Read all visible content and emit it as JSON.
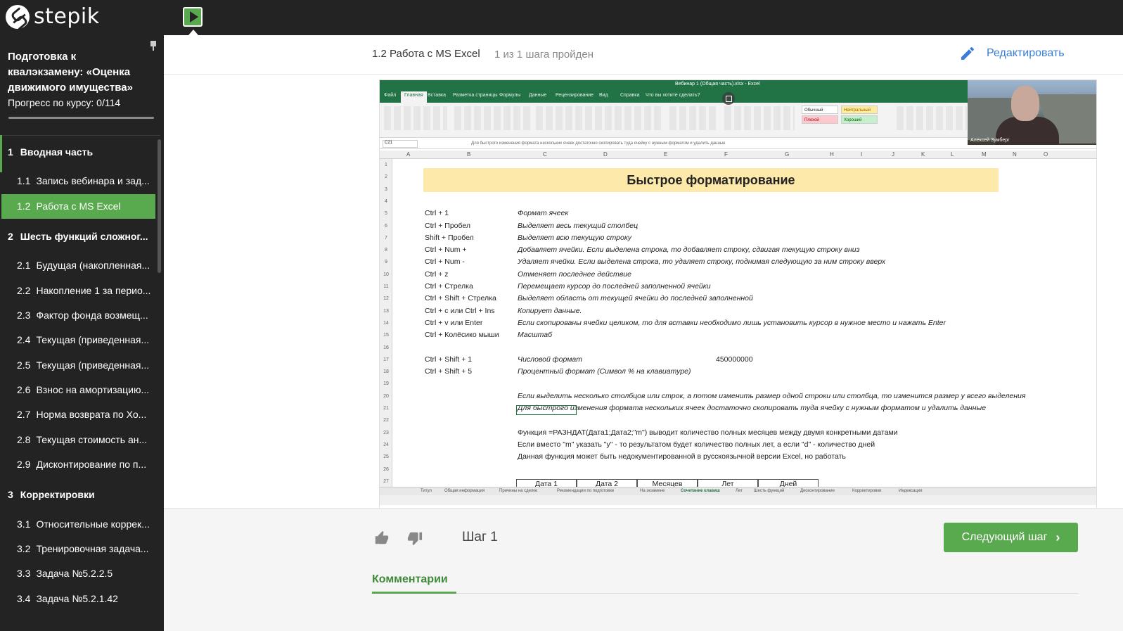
{
  "brand": {
    "name": "stepik"
  },
  "sidebar": {
    "course_title": "Подготовка к квалэкзамену: «Оценка движимого имущества»",
    "progress_label": "Прогресс по курсу:",
    "progress_value": "0/114",
    "progress_fraction": 0.0,
    "modules": [
      {
        "num": "1",
        "title": "Вводная часть",
        "lessons": [
          {
            "num": "1.1",
            "title": "Запись вебинара и зад..."
          },
          {
            "num": "1.2",
            "title": "Работа с MS Excel",
            "active": true
          }
        ]
      },
      {
        "num": "2",
        "title": "Шесть функций сложног...",
        "lessons": [
          {
            "num": "2.1",
            "title": "Будущая (накопленная..."
          },
          {
            "num": "2.2",
            "title": "Накопление 1 за перио..."
          },
          {
            "num": "2.3",
            "title": "Фактор фонда возмещ..."
          },
          {
            "num": "2.4",
            "title": "Текущая (приведенная..."
          },
          {
            "num": "2.5",
            "title": "Текущая (приведенная..."
          },
          {
            "num": "2.6",
            "title": "Взнос на амортизацию..."
          },
          {
            "num": "2.7",
            "title": "Норма возврата по Хо..."
          },
          {
            "num": "2.8",
            "title": "Текущая стоимость ан..."
          },
          {
            "num": "2.9",
            "title": "Дисконтирование по п..."
          }
        ]
      },
      {
        "num": "3",
        "title": "Корректировки",
        "lessons": [
          {
            "num": "3.1",
            "title": "Относительные коррек..."
          },
          {
            "num": "3.2",
            "title": "Тренировочная задача..."
          },
          {
            "num": "3.3",
            "title": "Задача №5.2.2.5"
          },
          {
            "num": "3.4",
            "title": "Задача №5.2.1.42"
          }
        ]
      }
    ]
  },
  "header": {
    "lesson_title": "1.2 Работа с MS Excel",
    "steps_status": "1 из 1 шага пройден",
    "edit_label": "Редактировать"
  },
  "video": {
    "excel_title": "Вебинар 1 (Общая часть).xlsx - Excel",
    "ribbon_tabs": [
      "Файл",
      "Главная",
      "Вставка",
      "Разметка страницы",
      "Формулы",
      "Данные",
      "Рецензирование",
      "Вид",
      "Справка",
      "Что вы хотите сделать?"
    ],
    "style_chips": [
      "Обычный",
      "Нейтральный",
      "Плохой",
      "Хороший"
    ],
    "cell_ref": "C21",
    "formula_text": "Для быстрого изменения формата нескольких ячеек достаточно скопировать туда ячейку с нужным форматом и удалить данные",
    "columns": [
      "A",
      "B",
      "C",
      "D",
      "E",
      "F",
      "G",
      "H",
      "I",
      "J",
      "K",
      "L",
      "M",
      "N",
      "O"
    ],
    "banner": "Быстрое форматирование",
    "shortcuts": [
      {
        "keys": "Ctrl + 1",
        "desc": "Формат ячеек"
      },
      {
        "keys": "Ctrl + Пробел",
        "desc": "Выделяет весь текущий столбец"
      },
      {
        "keys": "Shift + Пробел",
        "desc": "Выделяет всю текущую строку"
      },
      {
        "keys": "Ctrl + Num +",
        "desc": "Добавляет ячейки. Если выделена строка, то добавляет строку, сдвигая текущую строку вниз"
      },
      {
        "keys": "Ctrl + Num -",
        "desc": "Удаляет ячейки. Если выделена строка, то удаляет строку, поднимая следующую за ним строку вверх"
      },
      {
        "keys": "Ctrl + z",
        "desc": "Отменяет последнее действие"
      },
      {
        "keys": "Ctrl + Стрелка",
        "desc": "Перемещает курсор до последней заполненной ячейки"
      },
      {
        "keys": "Ctrl + Shift + Стрелка",
        "desc": "Выделяет область от текущей ячейки до последней заполненной"
      },
      {
        "keys": "Ctrl + c  или Ctrl + Ins",
        "desc": "Копирует данные."
      },
      {
        "keys": "Ctrl + v  или Enter",
        "desc": "Если скопированы ячейки целиком, то для вставки необходимо лишь установить курсор в нужное место и нажать Enter"
      },
      {
        "keys": "Ctrl + Колёсико мыши",
        "desc": "Масштаб"
      }
    ],
    "format_rows": [
      {
        "keys": "Ctrl + Shift + 1",
        "desc": "Числовой формат",
        "value": "450000000"
      },
      {
        "keys": "Ctrl + Shift + 5",
        "desc": "Процентный формат (Символ % на клавиатуре)"
      }
    ],
    "notes": [
      "Если выделить несколько столбцов или строк, а потом изменить размер одной строки или столбца, то изменится размер у всего выделения",
      "Для быстрого изменения формата нескольких ячеек достаточно скопировать туда ячейку с нужным форматом и удалить данные"
    ],
    "function_notes": [
      "Функция =РАЗНДАТ(Дата1;Дата2;\"m\") выводит количество полных месяцев между двумя конкретными датами",
      "Если вместо \"m\" указать \"y\" - то результатом будет количество полных лет, а если \"d\" - количество дней",
      "Данная функция может быть недокументированной в русскоязычной версии Excel, но работать"
    ],
    "table_headers": [
      "Дата 1",
      "Дата 2",
      "Месяцев",
      "Лет",
      "Дней"
    ],
    "sheet_tabs": [
      "Титул",
      "Общая информация",
      "Причины на сделке",
      "Рекомендации по подготовке",
      "На экзамене",
      "Сочетание клавиш",
      "Лет",
      "Шесть функций",
      "Дисконтирование",
      "Корректировки",
      "Индексация"
    ],
    "speaker_name": "Алексей Зумберг"
  },
  "footer": {
    "step_label": "Шаг 1",
    "next_label": "Следующий шаг",
    "comments_label": "Комментарии"
  },
  "colors": {
    "accent": "#59a94e",
    "link": "#3b7dd8",
    "dark": "#232323"
  }
}
